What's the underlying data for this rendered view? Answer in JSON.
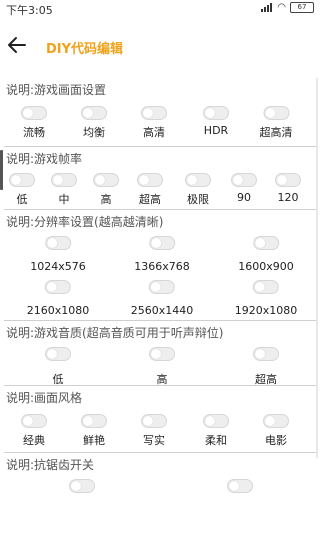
{
  "status": {
    "time": "下午3:05",
    "battery": "67"
  },
  "header": {
    "title": "DIY代码编辑"
  },
  "sections": [
    {
      "title": "说明:游戏画面设置",
      "options": [
        "流畅",
        "均衡",
        "高清",
        "HDR",
        "超高清"
      ]
    },
    {
      "title": "说明:游戏帧率",
      "options": [
        "低",
        "中",
        "高",
        "超高",
        "极限",
        "90",
        "120"
      ]
    },
    {
      "title": "说明:分辨率设置(越高越清晰)",
      "options": [
        "1024x576",
        "1366x768",
        "1600x900",
        "2160x1080",
        "2560x1440",
        "1920x1080"
      ]
    },
    {
      "title": "说明:游戏音质(超高音质可用于听声辩位)",
      "options": [
        "低",
        "高",
        "超高"
      ]
    },
    {
      "title": "说明:画面风格",
      "options": [
        "经典",
        "鲜艳",
        "写实",
        "柔和",
        "电影"
      ]
    },
    {
      "title": "说明:抗锯齿开关",
      "options": []
    }
  ]
}
